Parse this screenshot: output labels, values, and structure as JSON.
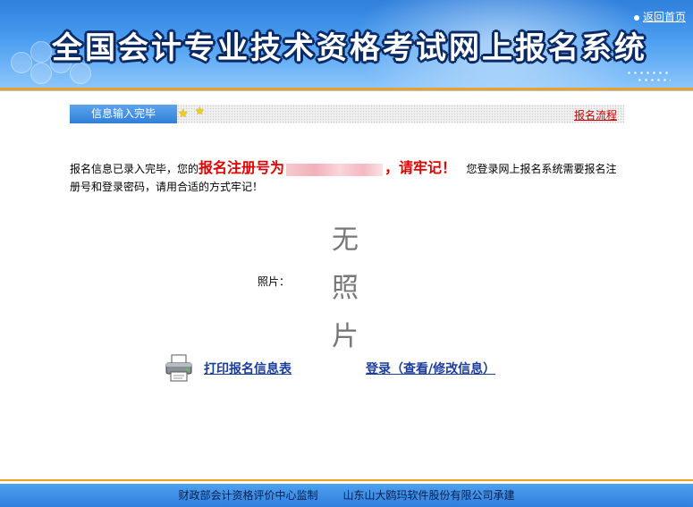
{
  "header": {
    "title": "全国会计专业技术资格考试网上报名系统",
    "home_link": "返回首页"
  },
  "stepbar": {
    "current_step": "信息输入完毕",
    "flow_link": "报名流程"
  },
  "message": {
    "text_before": "报名信息已录入完毕，您的",
    "highlight_prefix": "报名注册号为",
    "highlight_suffix": "，请牢记！",
    "text_after": "您登录网上报名系统需要报名注册号和登录密码，请用合适的方式牢记！"
  },
  "photo": {
    "label": "照片：",
    "placeholder_chars": [
      "无",
      "照",
      "片"
    ]
  },
  "actions": {
    "print_label": "打印报名信息表",
    "login_label": "登录（查看/修改信息）"
  },
  "footer": {
    "supervisor": "财政部会计资格评价中心监制",
    "developer": "山东山大鸥玛软件股份有限公司承建"
  },
  "colors": {
    "banner_blue": "#3d8fe6",
    "accent_orange": "#f0a020",
    "highlight_red": "#e00000",
    "link_blue": "#1a3d9c"
  }
}
